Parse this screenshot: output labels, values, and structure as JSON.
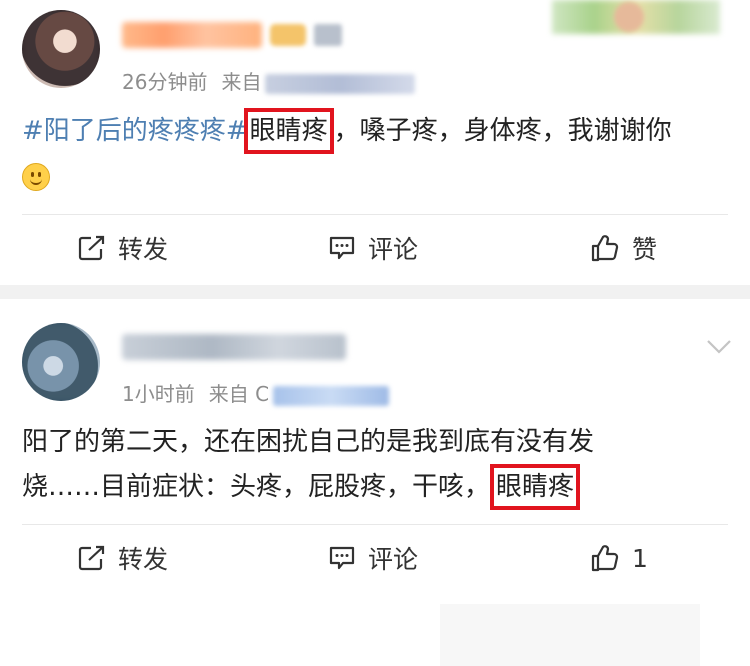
{
  "posts": [
    {
      "time": "26分钟前",
      "from_label": "来自",
      "content": {
        "hashtag": "#阳了后的疼疼疼#",
        "highlight": "眼睛疼",
        "after_highlight": "，嗓子疼，身体疼，我谢谢你"
      },
      "emoji": "smile-emoji",
      "actions": {
        "repost": "转发",
        "comment": "评论",
        "like": "赞"
      }
    },
    {
      "time": "1小时前",
      "from_label": "来自",
      "source_visible_char": "C",
      "content": {
        "line1": "阳了的第二天，还在困扰自己的是我到底有没有发",
        "line2_prefix": "烧……目前症状：头疼，屁股疼，干咳，",
        "highlight": "眼睛疼"
      },
      "actions": {
        "repost": "转发",
        "comment": "评论",
        "like": "1"
      }
    }
  ],
  "colors": {
    "highlight_border": "#e1141e",
    "hashtag": "#4e7fb2",
    "meta_text": "#8d8d8d",
    "separator": "#f1f1f1"
  }
}
